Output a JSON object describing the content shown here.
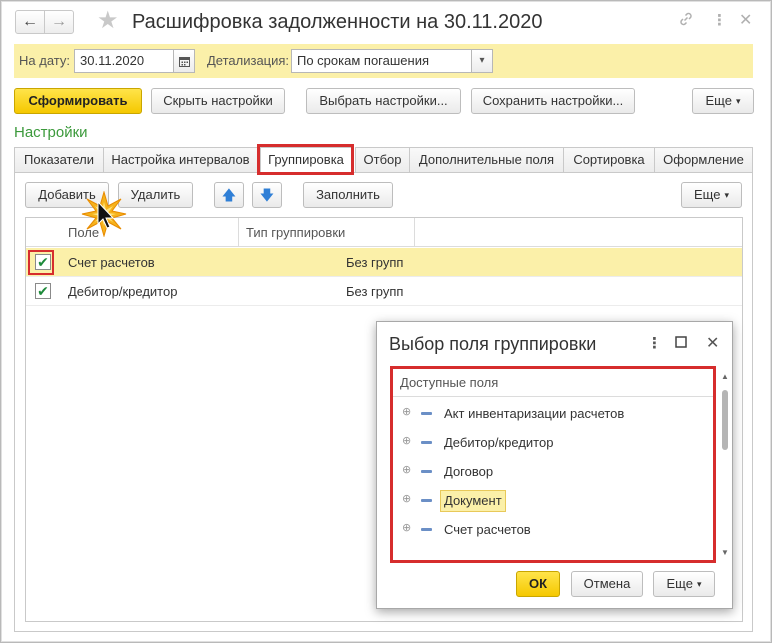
{
  "titlebar": {
    "back_icon": "arrow-left-icon",
    "forward_icon": "arrow-right-icon",
    "title": "Расшифровка задолженности на 30.11.2020"
  },
  "params": {
    "date_label": "На дату:",
    "date_value": "30.11.2020",
    "detail_label": "Детализация:",
    "detail_value": "По срокам погашения"
  },
  "toolbar": {
    "generate": "Сформировать",
    "hide_settings": "Скрыть настройки",
    "choose_settings": "Выбрать настройки...",
    "save_settings": "Сохранить настройки...",
    "more": "Еще"
  },
  "settings": {
    "title": "Настройки",
    "tabs": [
      {
        "label": "Показатели"
      },
      {
        "label": "Настройка интервалов"
      },
      {
        "label": "Группировка"
      },
      {
        "label": "Отбор"
      },
      {
        "label": "Дополнительные поля"
      },
      {
        "label": "Сортировка"
      },
      {
        "label": "Оформление"
      }
    ],
    "active_tab": "Группировка"
  },
  "grouping": {
    "add": "Добавить",
    "delete": "Удалить",
    "fill": "Заполнить",
    "more": "Еще",
    "columns": {
      "field": "Поле",
      "group_type": "Тип группировки"
    },
    "rows": [
      {
        "field": "Счет расчетов",
        "group_type": "Без групп",
        "checked": true,
        "selected": true
      },
      {
        "field": "Дебитор/кредитор",
        "group_type": "Без групп",
        "checked": true,
        "selected": false
      }
    ]
  },
  "dialog": {
    "title": "Выбор поля группировки",
    "tree_header": "Доступные поля",
    "items": [
      {
        "label": "Акт инвентаризации расчетов"
      },
      {
        "label": "Дебитор/кредитор"
      },
      {
        "label": "Договор"
      },
      {
        "label": "Документ"
      },
      {
        "label": "Счет расчетов"
      }
    ],
    "selected_item": "Документ",
    "ok": "ОК",
    "cancel": "Отмена",
    "more": "Еще"
  },
  "colors": {
    "accent_yellow": "#fbf0a9",
    "primary_button": "#f5c800",
    "highlight_red": "#d62d2d",
    "section_green": "#3c9a3c"
  }
}
